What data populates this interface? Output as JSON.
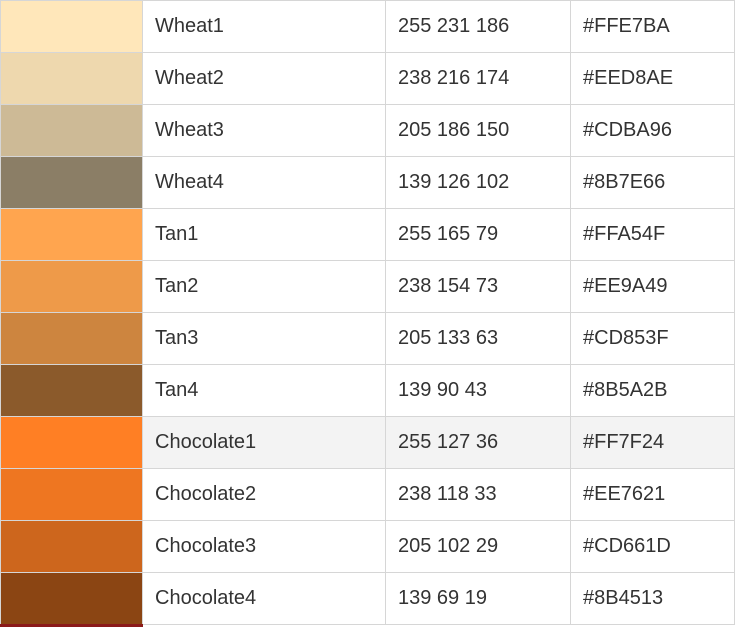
{
  "highlight_color": "#f3f3f3",
  "rows": [
    {
      "name": "Wheat1",
      "rgb": "255 231 186",
      "hex": "#FFE7BA",
      "color": "#FFE7BA"
    },
    {
      "name": "Wheat2",
      "rgb": "238 216 174",
      "hex": "#EED8AE",
      "color": "#EED8AE"
    },
    {
      "name": "Wheat3",
      "rgb": "205 186 150",
      "hex": "#CDBA96",
      "color": "#CDBA96"
    },
    {
      "name": "Wheat4",
      "rgb": "139 126 102",
      "hex": "#8B7E66",
      "color": "#8B7E66"
    },
    {
      "name": "Tan1",
      "rgb": "255 165 79",
      "hex": "#FFA54F",
      "color": "#FFA54F"
    },
    {
      "name": "Tan2",
      "rgb": "238 154 73",
      "hex": "#EE9A49",
      "color": "#EE9A49"
    },
    {
      "name": "Tan3",
      "rgb": "205 133 63",
      "hex": "#CD853F",
      "color": "#CD853F"
    },
    {
      "name": "Tan4",
      "rgb": "139 90 43",
      "hex": "#8B5A2B",
      "color": "#8B5A2B"
    },
    {
      "name": "Chocolate1",
      "rgb": "255 127 36",
      "hex": "#FF7F24",
      "color": "#FF7F24",
      "highlighted": true
    },
    {
      "name": "Chocolate2",
      "rgb": "238 118 33",
      "hex": "#EE7621",
      "color": "#EE7621"
    },
    {
      "name": "Chocolate3",
      "rgb": "205 102 29",
      "hex": "#CD661D",
      "color": "#CD661D"
    },
    {
      "name": "Chocolate4",
      "rgb": "139 69 19",
      "hex": "#8B4513",
      "color": "#8B4513"
    }
  ],
  "next_row_swatch_color": "#8B1A1A"
}
